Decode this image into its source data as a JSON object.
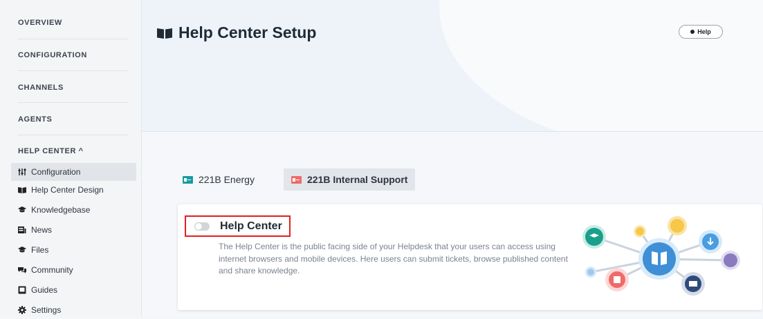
{
  "sidebar": {
    "sections": [
      "OVERVIEW",
      "CONFIGURATION",
      "CHANNELS",
      "AGENTS",
      "HELP CENTER ^"
    ],
    "items": [
      {
        "label": "Configuration",
        "icon": "sliders-icon",
        "active": true
      },
      {
        "label": "Help Center Design",
        "icon": "book-icon"
      },
      {
        "label": "Knowledgebase",
        "icon": "graduation-cap-icon"
      },
      {
        "label": "News",
        "icon": "news-icon"
      },
      {
        "label": "Files",
        "icon": "files-icon"
      },
      {
        "label": "Community",
        "icon": "chat-icon"
      },
      {
        "label": "Guides",
        "icon": "guide-icon"
      },
      {
        "label": "Settings",
        "icon": "gear-icon"
      }
    ]
  },
  "header": {
    "title": "Help Center Setup",
    "help_label": "Help"
  },
  "brands": [
    {
      "name": "221B Energy",
      "color": "#1a9ba1",
      "selected": false
    },
    {
      "name": "221B Internal Support",
      "color": "#f06a6a",
      "selected": true
    }
  ],
  "card": {
    "toggle_label": "Help Center",
    "toggle_on": false,
    "description": "The Help Center is the public facing side of your Helpdesk that your users can access using internet browsers and mobile devices. Here users can submit tickets, browse published content and share knowledge."
  },
  "colors": {
    "highlight": "#e02020",
    "teal": "#1aa08a",
    "blue": "#4a9de0",
    "coral": "#f06a6a",
    "navy": "#2f4a7a",
    "purple": "#8a7bc0",
    "yellow": "#f6c84a"
  }
}
